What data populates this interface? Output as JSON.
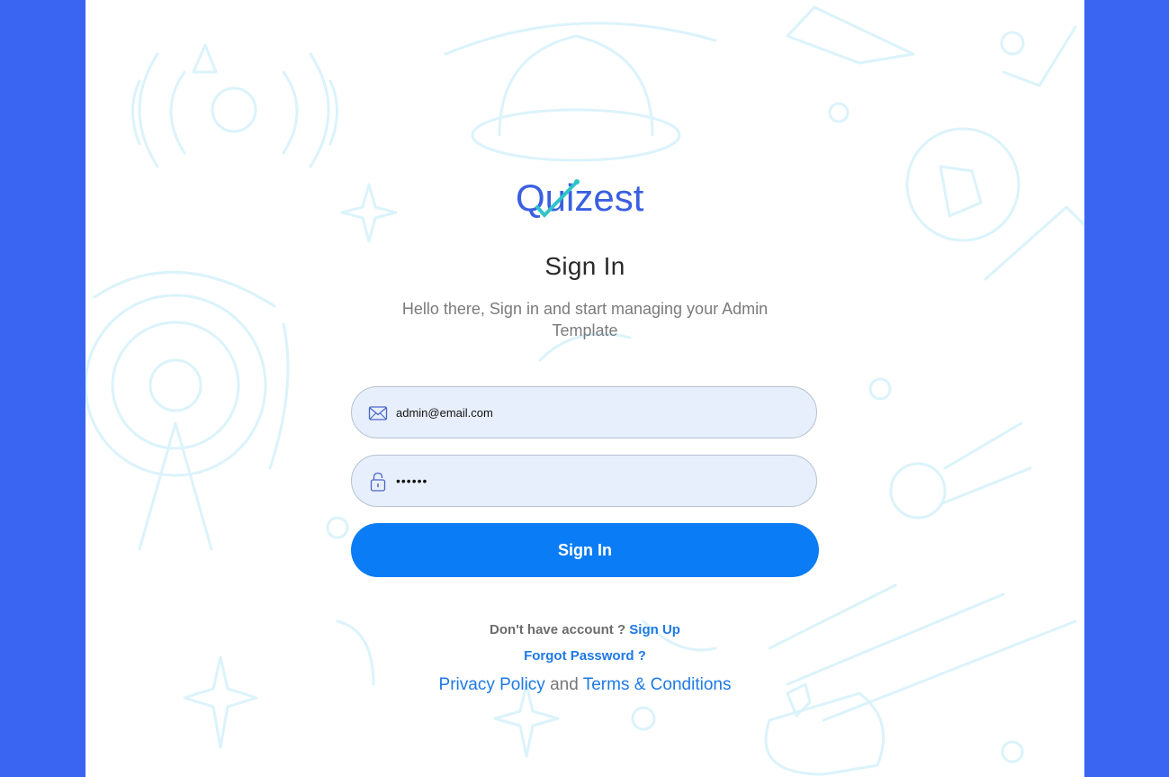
{
  "colors": {
    "background": "#3a65f2",
    "panel": "#ffffff",
    "accent": "#0a7cf5",
    "link": "#1e79e6",
    "field_bg": "#e8effc"
  },
  "brand": {
    "name": "Quizest"
  },
  "signin": {
    "title": "Sign In",
    "subtitle": "Hello there, Sign in and start managing your Admin Template",
    "email": {
      "value": "admin@email.com",
      "icon": "envelope-icon"
    },
    "password": {
      "value": "••••••",
      "icon": "lock-icon"
    },
    "button_label": "Sign In"
  },
  "footer": {
    "no_account_text": "Don't have account ?",
    "signup_label": "Sign Up",
    "forgot_label": "Forgot Password ?",
    "privacy_label": "Privacy Policy",
    "and_text": "and",
    "terms_label": "Terms & Conditions"
  }
}
